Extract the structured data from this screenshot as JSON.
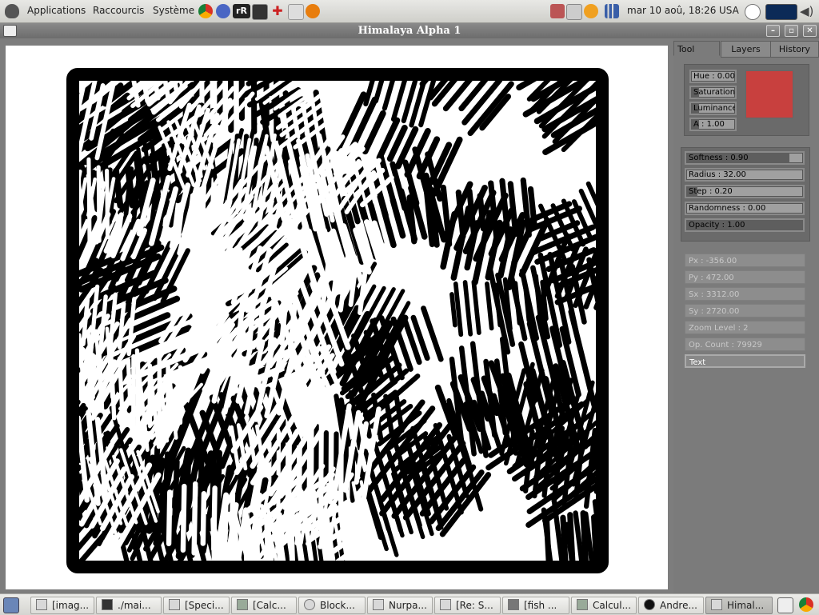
{
  "top_panel": {
    "applications": "Applications",
    "shortcuts": "Raccourcis",
    "system": "Système",
    "rr_label": "rR",
    "datetime": "mar 10 aoû, 18:26",
    "layout": "USA"
  },
  "window": {
    "title": "Himalaya Alpha 1",
    "minimize_label": "–",
    "maximize_label": "▫",
    "close_label": "✕"
  },
  "panel": {
    "tabs": [
      "Tool",
      "Layers",
      "History"
    ],
    "active_tab": "Tool",
    "color": {
      "hue": "Hue : 0.00",
      "saturation": "Saturation",
      "luminance": "Luminance",
      "alpha": "A : 1.00",
      "swatch": "#c8403e"
    },
    "brush": {
      "softness": "Softness : 0.90",
      "radius": "Radius : 32.00",
      "step": "Step : 0.20",
      "randomness": "Randomness : 0.00",
      "opacity": "Opacity : 1.00"
    },
    "brush_levels": {
      "softness": 0.9,
      "radius": 0.0,
      "step": 0.1,
      "randomness": 0.0,
      "opacity": 1.0
    },
    "info": {
      "px": "Px : -356.00",
      "py": "Py : 472.00",
      "sx": "Sx : 3312.00",
      "sy": "Sy : 2720.00",
      "zoom": "Zoom Level : 2",
      "op_count": "Op. Count : 79929",
      "text_field": "Text"
    }
  },
  "taskbar": {
    "items": [
      "[imag...",
      "./mai...",
      "[Speci...",
      "[Calc...",
      "Block...",
      "Nurpa...",
      "[Re: S...",
      "[fish ...",
      "Calcul...",
      "Andre...",
      "Himal..."
    ]
  }
}
